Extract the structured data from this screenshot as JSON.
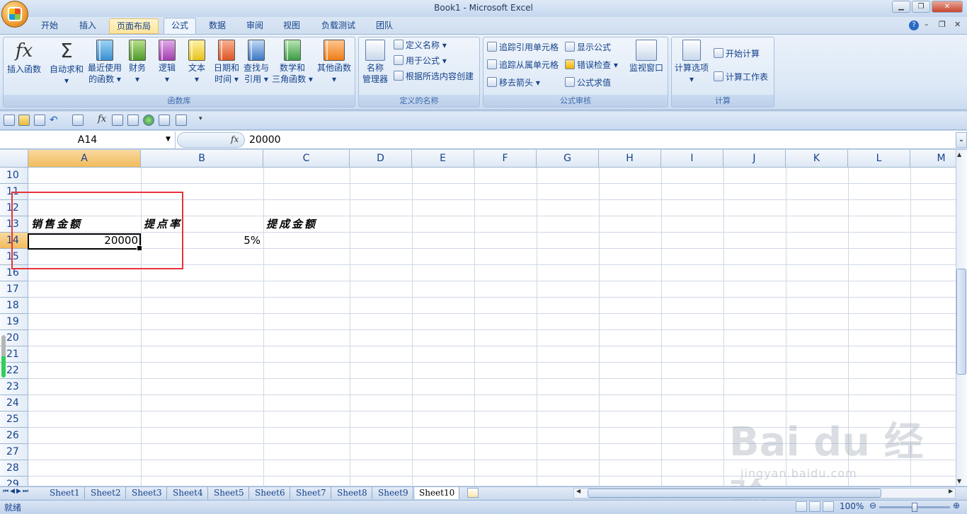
{
  "window": {
    "title": "Book1 - Microsoft Excel"
  },
  "tabs": [
    "开始",
    "插入",
    "页面布局",
    "公式",
    "数据",
    "审阅",
    "视图",
    "负载测试",
    "团队"
  ],
  "ribbon": {
    "function_library": {
      "label": "函数库",
      "buttons": [
        {
          "label1": "插入函数",
          "label2": ""
        },
        {
          "label1": "自动求和",
          "label2": "▾"
        },
        {
          "label1": "最近使用",
          "label2": "的函数 ▾"
        },
        {
          "label1": "财务",
          "label2": "▾"
        },
        {
          "label1": "逻辑",
          "label2": "▾"
        },
        {
          "label1": "文本",
          "label2": "▾"
        },
        {
          "label1": "日期和",
          "label2": "时间 ▾"
        },
        {
          "label1": "查找与",
          "label2": "引用 ▾"
        },
        {
          "label1": "数学和",
          "label2": "三角函数 ▾"
        },
        {
          "label1": "其他函数",
          "label2": "▾"
        }
      ]
    },
    "defined_names": {
      "label": "定义的名称",
      "manager1": "名称",
      "manager2": "管理器",
      "define": "定义名称 ▾",
      "use": "用于公式 ▾",
      "create": "根据所选内容创建"
    },
    "formula_auditing": {
      "label": "公式审核",
      "trace_precedents": "追踪引用单元格",
      "trace_dependents": "追踪从属单元格",
      "remove_arrows": "移去箭头 ▾",
      "show_formulas": "显示公式",
      "error_check": "错误检查 ▾",
      "evaluate": "公式求值",
      "watch": "监视窗口"
    },
    "calculation": {
      "label": "计算",
      "options1": "计算选项",
      "options2": "▾",
      "calc_now": "开始计算",
      "calc_sheet": "计算工作表"
    }
  },
  "formula_bar": {
    "name_box": "A14",
    "fx": "fx",
    "content": "20000"
  },
  "columns": [
    "A",
    "B",
    "C",
    "D",
    "E",
    "F",
    "G",
    "H",
    "I",
    "J",
    "K",
    "L",
    "M"
  ],
  "rows": [
    "10",
    "11",
    "12",
    "13",
    "14",
    "15",
    "16",
    "17",
    "18",
    "19",
    "20",
    "21",
    "22",
    "23",
    "24",
    "25",
    "26",
    "27",
    "28",
    "29"
  ],
  "cells": {
    "A13": "销售金额",
    "B13": "提点率",
    "C13": "提成金额",
    "A14": "20000",
    "B14": "5%"
  },
  "sheets": [
    "Sheet1",
    "Sheet2",
    "Sheet3",
    "Sheet4",
    "Sheet5",
    "Sheet6",
    "Sheet7",
    "Sheet8",
    "Sheet9",
    "Sheet10"
  ],
  "active_sheet": "Sheet10",
  "status": {
    "text": "就绪",
    "zoom": "100%"
  },
  "watermark": {
    "logo": "Bai du 经验",
    "url": "jingyan.baidu.com"
  }
}
